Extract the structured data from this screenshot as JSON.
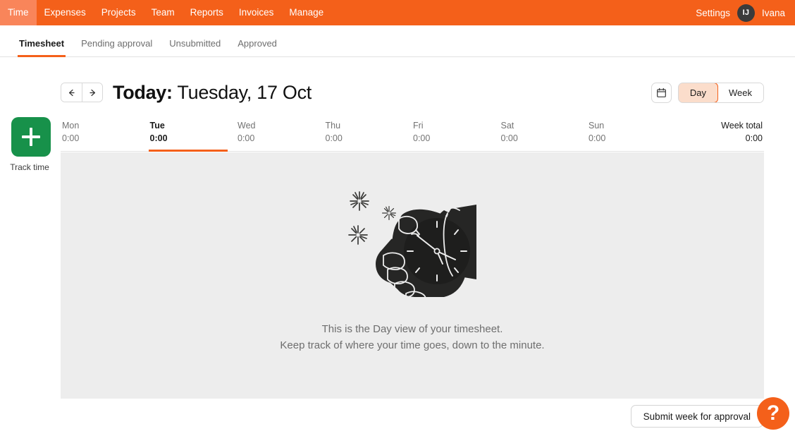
{
  "topbar": {
    "nav": [
      {
        "label": "Time",
        "active": true
      },
      {
        "label": "Expenses",
        "active": false
      },
      {
        "label": "Projects",
        "active": false
      },
      {
        "label": "Team",
        "active": false
      },
      {
        "label": "Reports",
        "active": false
      },
      {
        "label": "Invoices",
        "active": false
      },
      {
        "label": "Manage",
        "active": false
      }
    ],
    "settings_label": "Settings",
    "avatar_initials": "IJ",
    "user_name": "Ivana",
    "bar_color": "#F4601A",
    "active_tab_color": "#F9855A"
  },
  "subnav": {
    "items": [
      {
        "label": "Timesheet",
        "active": true
      },
      {
        "label": "Pending approval",
        "active": false
      },
      {
        "label": "Unsubmitted",
        "active": false
      },
      {
        "label": "Approved",
        "active": false
      }
    ],
    "accent_color": "#F4601A"
  },
  "date_header": {
    "prev_arrow": "←",
    "next_arrow": "→",
    "today_label": "Today:",
    "date_label": "Tuesday, 17 Oct",
    "calendar_icon": "calendar-icon",
    "view_options": [
      {
        "label": "Day",
        "active": true
      },
      {
        "label": "Week",
        "active": false
      }
    ]
  },
  "track_time": {
    "label": "Track time",
    "icon": "plus-icon",
    "color": "#17914A"
  },
  "week_strip": {
    "days": [
      {
        "name": "Mon",
        "value": "0:00",
        "active": false
      },
      {
        "name": "Tue",
        "value": "0:00",
        "active": true
      },
      {
        "name": "Wed",
        "value": "0:00",
        "active": false
      },
      {
        "name": "Thu",
        "value": "0:00",
        "active": false
      },
      {
        "name": "Fri",
        "value": "0:00",
        "active": false
      },
      {
        "name": "Sat",
        "value": "0:00",
        "active": false
      },
      {
        "name": "Sun",
        "value": "0:00",
        "active": false
      }
    ],
    "total": {
      "name": "Week total",
      "value": "0:00"
    }
  },
  "empty_state": {
    "illustration": "hand-holding-stopwatch-illustration",
    "line1": "This is the Day view of your timesheet.",
    "line2": "Keep track of where your time goes, down to the minute.",
    "background_color": "#EDEDED"
  },
  "footer": {
    "submit_label": "Submit week for approval",
    "help_label": "?",
    "help_color": "#F4601A"
  }
}
